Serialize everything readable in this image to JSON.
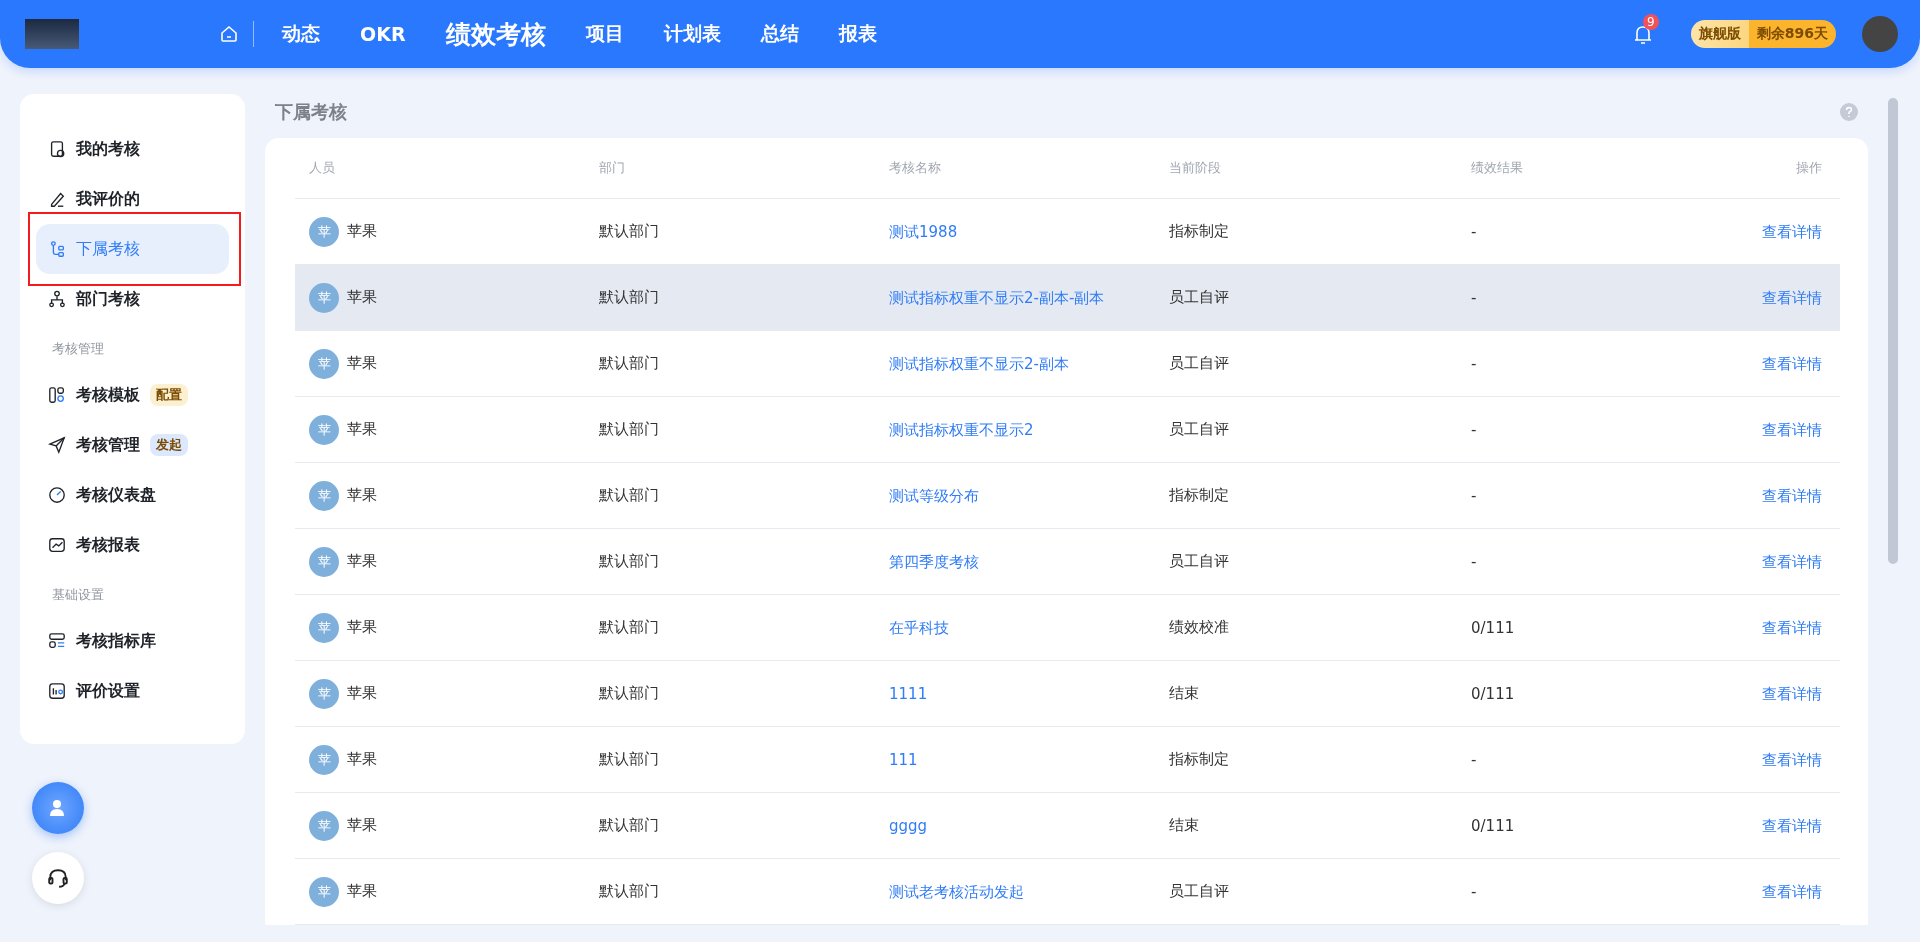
{
  "nav": {
    "items": [
      {
        "label": "动态",
        "selected": false
      },
      {
        "label": "OKR",
        "selected": false
      },
      {
        "label": "绩效考核",
        "selected": true
      },
      {
        "label": "项目",
        "selected": false
      },
      {
        "label": "计划表",
        "selected": false
      },
      {
        "label": "总结",
        "selected": false
      },
      {
        "label": "报表",
        "selected": false
      }
    ],
    "notification_count": "9",
    "plan": "旗舰版",
    "remaining": "剩余896天"
  },
  "sidebar": {
    "items": [
      {
        "kind": "item",
        "label": "我的考核",
        "selected": false,
        "highlighted": false
      },
      {
        "kind": "item",
        "label": "我评价的",
        "selected": false,
        "highlighted": false
      },
      {
        "kind": "item",
        "label": "下属考核",
        "selected": true,
        "highlighted": true
      },
      {
        "kind": "item",
        "label": "部门考核",
        "selected": false,
        "highlighted": false
      },
      {
        "kind": "section",
        "label": "考核管理"
      },
      {
        "kind": "item",
        "label": "考核模板",
        "selected": false,
        "highlighted": false,
        "tag": {
          "label": "配置",
          "color": "#fdf0d0"
        }
      },
      {
        "kind": "item",
        "label": "考核管理",
        "selected": false,
        "highlighted": false,
        "tag": {
          "label": "发起",
          "color": "#dbe8fd"
        }
      },
      {
        "kind": "item",
        "label": "考核仪表盘",
        "selected": false,
        "highlighted": false
      },
      {
        "kind": "item",
        "label": "考核报表",
        "selected": false,
        "highlighted": false
      },
      {
        "kind": "section",
        "label": "基础设置"
      },
      {
        "kind": "item",
        "label": "考核指标库",
        "selected": false,
        "highlighted": false
      },
      {
        "kind": "item",
        "label": "评价设置",
        "selected": false,
        "highlighted": false
      }
    ]
  },
  "page": {
    "title": "下属考核"
  },
  "table": {
    "columns": [
      "人员",
      "部门",
      "考核名称",
      "当前阶段",
      "绩效结果",
      "操作"
    ],
    "rows": [
      {
        "avatar": "苹",
        "person": "苹果",
        "dept": "默认部门",
        "name": "测试1988",
        "stage": "指标制定",
        "result": "-",
        "action": "查看详情",
        "hovered": false
      },
      {
        "avatar": "苹",
        "person": "苹果",
        "dept": "默认部门",
        "name": "测试指标权重不显示2-副本-副本",
        "stage": "员工自评",
        "result": "-",
        "action": "查看详情",
        "hovered": true
      },
      {
        "avatar": "苹",
        "person": "苹果",
        "dept": "默认部门",
        "name": "测试指标权重不显示2-副本",
        "stage": "员工自评",
        "result": "-",
        "action": "查看详情",
        "hovered": false
      },
      {
        "avatar": "苹",
        "person": "苹果",
        "dept": "默认部门",
        "name": "测试指标权重不显示2",
        "stage": "员工自评",
        "result": "-",
        "action": "查看详情",
        "hovered": false
      },
      {
        "avatar": "苹",
        "person": "苹果",
        "dept": "默认部门",
        "name": "测试等级分布",
        "stage": "指标制定",
        "result": "-",
        "action": "查看详情",
        "hovered": false
      },
      {
        "avatar": "苹",
        "person": "苹果",
        "dept": "默认部门",
        "name": "第四季度考核",
        "stage": "员工自评",
        "result": "-",
        "action": "查看详情",
        "hovered": false
      },
      {
        "avatar": "苹",
        "person": "苹果",
        "dept": "默认部门",
        "name": "在乎科技",
        "stage": "绩效校准",
        "result": "0/111",
        "action": "查看详情",
        "hovered": false
      },
      {
        "avatar": "苹",
        "person": "苹果",
        "dept": "默认部门",
        "name": "1111",
        "stage": "结束",
        "result": "0/111",
        "action": "查看详情",
        "hovered": false
      },
      {
        "avatar": "苹",
        "person": "苹果",
        "dept": "默认部门",
        "name": "111",
        "stage": "指标制定",
        "result": "-",
        "action": "查看详情",
        "hovered": false
      },
      {
        "avatar": "苹",
        "person": "苹果",
        "dept": "默认部门",
        "name": "gggg",
        "stage": "结束",
        "result": "0/111",
        "action": "查看详情",
        "hovered": false
      },
      {
        "avatar": "苹",
        "person": "苹果",
        "dept": "默认部门",
        "name": "测试老考核活动发起",
        "stage": "员工自评",
        "result": "-",
        "action": "查看详情",
        "hovered": false
      }
    ]
  }
}
